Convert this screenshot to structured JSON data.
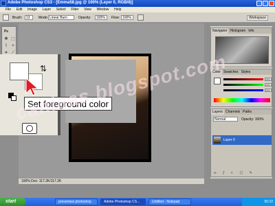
{
  "window": {
    "title": "Adobe Photoshop CS3 - [Emma58.jpg @ 100% (Layer 0, RGB/8)]"
  },
  "menu": [
    "File",
    "Edit",
    "Image",
    "Layer",
    "Select",
    "Filter",
    "View",
    "Window",
    "Help"
  ],
  "options": {
    "brush_label": "Brush:",
    "brush_size": "13",
    "mode_label": "Mode:",
    "mode_value": "Linear Burn",
    "opacity_label": "Opacity:",
    "opacity_value": "100%",
    "flow_label": "Flow:",
    "flow_value": "100%",
    "workspace": "Workspace"
  },
  "tooltip": "Set foreground color",
  "panels": {
    "navigator_tabs": [
      "Navigator",
      "Histogram",
      "Info"
    ],
    "color_tabs": [
      "Color",
      "Swatches",
      "Styles"
    ],
    "color_values": [
      "255",
      "255",
      "255"
    ],
    "layers_tabs": [
      "Layers",
      "Channels",
      "Paths"
    ],
    "blend_mode": "Normal",
    "layer_opacity": "Opacity: 100%",
    "layer_name": "Layer 0"
  },
  "status": "100%    Doc: 117.2K/117.2K",
  "taskbar": {
    "start": "start",
    "items": [
      "presentasi photoshop",
      "Adobe Photoshop CS...",
      "Untitled - Notepad"
    ],
    "clock": "05:22"
  },
  "watermark": "caniaas.blogspot.com",
  "colors": {
    "titlebar": "#0b47c2",
    "taskbar": "#245edb",
    "start": "#2e8c2e",
    "tooltip_arrow": "#e01b24"
  }
}
